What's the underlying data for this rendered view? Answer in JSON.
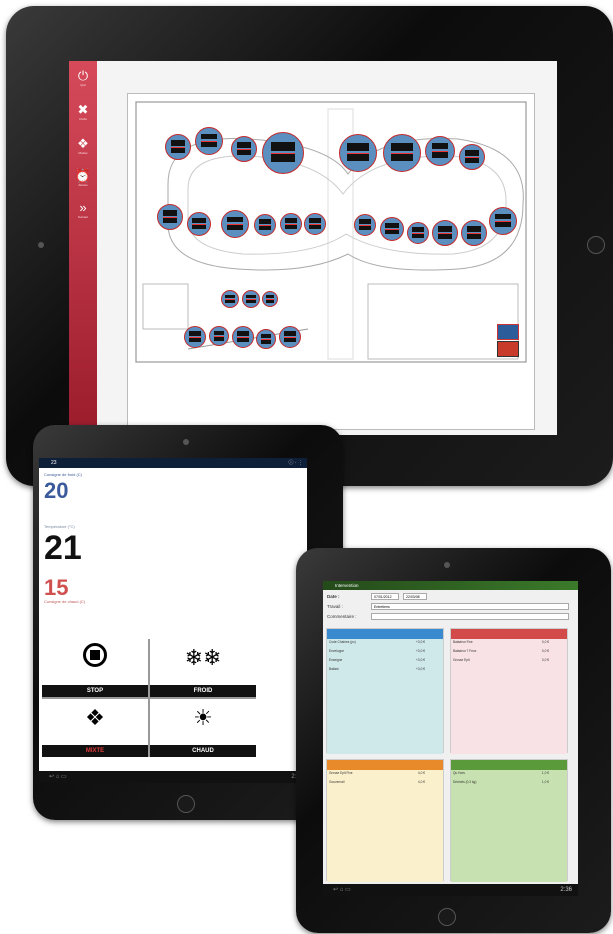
{
  "tablet_plan": {
    "sidebar": [
      {
        "icon": "power-icon",
        "glyph": "⏻",
        "label": "Quit"
      },
      {
        "icon": "tools-icon",
        "glyph": "✖",
        "label": "Outils"
      },
      {
        "icon": "mode-icon",
        "glyph": "❖",
        "label": "Modes"
      },
      {
        "icon": "alarm-icon",
        "glyph": "⏰",
        "label": "Alertes"
      },
      {
        "icon": "next-icon",
        "glyph": "»",
        "label": "Suivant"
      }
    ]
  },
  "tablet_thermo": {
    "header_number": "23",
    "consigne_froid_label": "Consigne de froid (C)",
    "consigne_froid": "20",
    "temperature_label": "Température (°C)",
    "temperature": "21",
    "consigne_chaud": "15",
    "consigne_chaud_label": "Consigne de chaud (C)",
    "buttons": [
      {
        "label": "STOP",
        "glyph": "■",
        "color": "#ffffff"
      },
      {
        "label": "FROID",
        "glyph": "❄❄",
        "color": "#ffffff"
      },
      {
        "label": "MIXTE",
        "glyph": "❖",
        "color": "#e03a3a"
      },
      {
        "label": "CHAUD",
        "glyph": "☀",
        "color": "#ffffff"
      }
    ],
    "clock": "2:47"
  },
  "tablet_form": {
    "title": "Intervention",
    "date_label": "Date :",
    "date_value": "07/01/2012",
    "time_value": "22/03/08",
    "travail_label": "Travail :",
    "travail_value": "Entretiens",
    "comment_label": "Commentaire :",
    "quadrants": [
      {
        "color": "#3a8ad0",
        "bg": "#cfe8ea",
        "lines": [
          [
            "Code Chaînes (pc)",
            "+3,0 €"
          ],
          [
            "Enveloppe",
            "+3,0 €"
          ],
          [
            "Enseigne",
            "+3,0 €"
          ],
          [
            "Ballast",
            "+3,0 €"
          ]
        ]
      },
      {
        "color": "#d24a4a",
        "bg": "#f8e2e6",
        "lines": [
          [
            "Baladeur Fixe",
            "0,0 €"
          ],
          [
            "Baladeur 7 Feux",
            "0,0 €"
          ],
          [
            "Grosse Eplt",
            "0,0 €"
          ]
        ]
      },
      {
        "color": "#e88a2a",
        "bg": "#fbf0cc",
        "lines": [
          [
            "Grosse Eplt Fixe",
            "4,0 €"
          ],
          [
            "Gouvernail",
            "4,0 €"
          ]
        ]
      },
      {
        "color": "#5a9a3a",
        "bg": "#c7e2b0",
        "lines": [
          [
            "Qu Hors",
            "1,0 €"
          ],
          [
            "Déchets (0,3 kg)",
            "1,0 €"
          ]
        ]
      }
    ],
    "clock": "2:36"
  }
}
